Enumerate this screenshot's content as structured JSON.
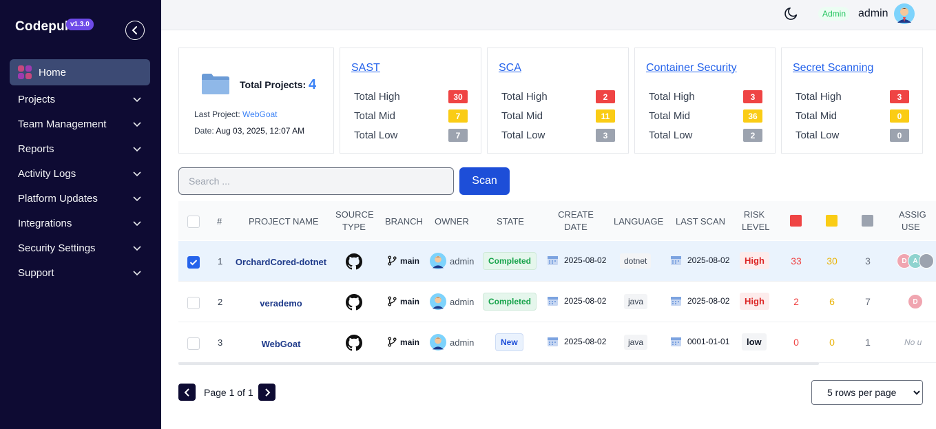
{
  "app": {
    "logo": "Codepulse",
    "version": "v1.3.0"
  },
  "sidebar": {
    "home": "Home",
    "items": [
      {
        "label": "Projects"
      },
      {
        "label": "Team Management"
      },
      {
        "label": "Reports"
      },
      {
        "label": "Activity Logs"
      },
      {
        "label": "Platform Updates"
      },
      {
        "label": "Integrations"
      },
      {
        "label": "Security Settings"
      },
      {
        "label": "Support"
      }
    ]
  },
  "header": {
    "role": "Admin",
    "username": "admin"
  },
  "projects_card": {
    "label": "Total Projects:",
    "value": "4",
    "last_project_label": "Last Project:",
    "last_project": "WebGoat",
    "date_label": "Date:",
    "date": "Aug 03, 2025, 12:07 AM"
  },
  "stats": [
    {
      "title": "SAST",
      "high": "30",
      "mid": "7",
      "low": "7"
    },
    {
      "title": "SCA",
      "high": "2",
      "mid": "11",
      "low": "3"
    },
    {
      "title": "Container Security",
      "high": "3",
      "mid": "36",
      "low": "2"
    },
    {
      "title": "Secret Scanning",
      "high": "3",
      "mid": "0",
      "low": "0"
    }
  ],
  "stat_labels": {
    "high": "Total High",
    "mid": "Total Mid",
    "low": "Total Low"
  },
  "search": {
    "placeholder": "Search ..."
  },
  "scan_label": "Scan",
  "table": {
    "headers": {
      "num": "#",
      "name": "PROJECT NAME",
      "source1": "SOURCE",
      "source2": "TYPE",
      "branch": "BRANCH",
      "owner": "OWNER",
      "state": "STATE",
      "create1": "CREATE",
      "create2": "DATE",
      "language": "LANGUAGE",
      "last_scan": "LAST SCAN",
      "risk1": "RISK",
      "risk2": "LEVEL",
      "assign1": "ASSIG",
      "assign2": "USE"
    },
    "rows": [
      {
        "index": "1",
        "name": "OrchardCored-dotnet",
        "branch": "main",
        "owner": "admin",
        "state": "Completed",
        "create_date": "2025-08-02",
        "language": "dotnet",
        "last_scan": "2025-08-02",
        "risk": "High",
        "high": "33",
        "mid": "30",
        "low": "3",
        "users": [
          "D",
          "A",
          ""
        ]
      },
      {
        "index": "2",
        "name": "verademo",
        "branch": "main",
        "owner": "admin",
        "state": "Completed",
        "create_date": "2025-08-02",
        "language": "java",
        "last_scan": "2025-08-02",
        "risk": "High",
        "high": "2",
        "mid": "6",
        "low": "7",
        "users": [
          "D"
        ]
      },
      {
        "index": "3",
        "name": "WebGoat",
        "branch": "main",
        "owner": "admin",
        "state": "New",
        "create_date": "2025-08-02",
        "language": "java",
        "last_scan": "0001-01-01",
        "risk": "low",
        "high": "0",
        "mid": "0",
        "low": "1",
        "users_text": "No u"
      }
    ]
  },
  "pagination": {
    "text": "Page 1 of 1",
    "rows_per_page": "5 rows per page"
  },
  "colors": {
    "sidebar": "#0e0b33",
    "accent": "#1d4ed8",
    "high": "#ef4444",
    "mid": "#facc15",
    "low": "#9ca3af"
  }
}
